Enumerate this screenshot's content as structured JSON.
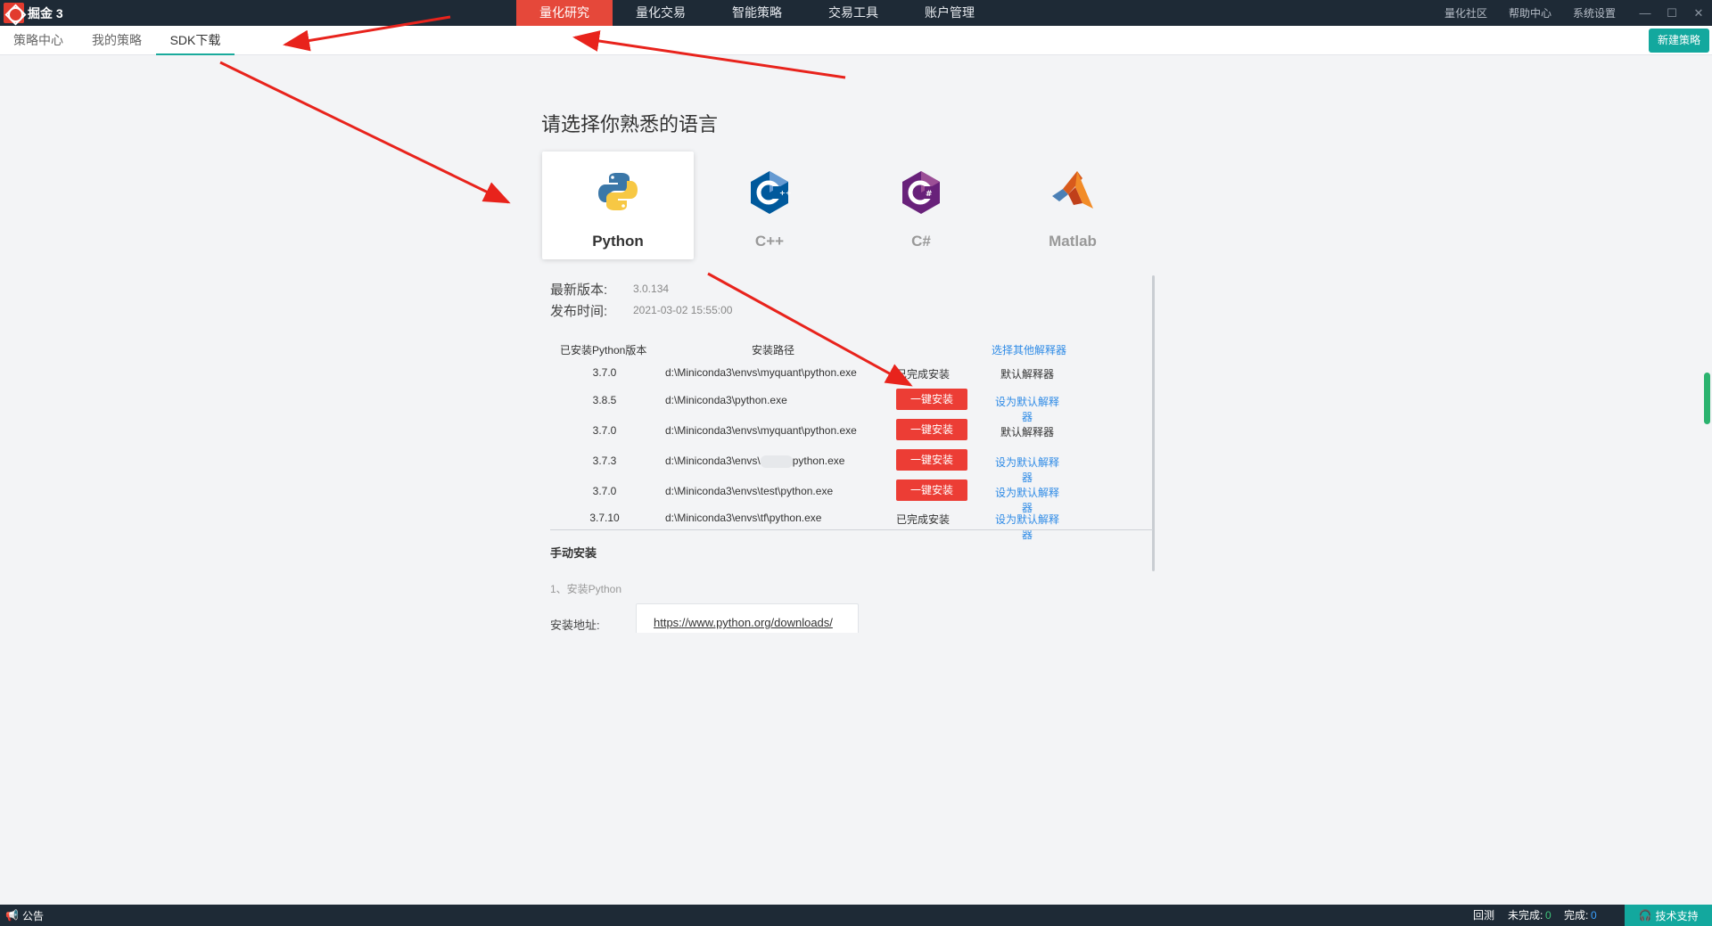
{
  "app": {
    "logo_text": "掘金 3"
  },
  "main_nav": [
    {
      "label": "量化研究",
      "active": true
    },
    {
      "label": "量化交易",
      "active": false
    },
    {
      "label": "智能策略",
      "active": false
    },
    {
      "label": "交易工具",
      "active": false
    },
    {
      "label": "账户管理",
      "active": false
    }
  ],
  "top_right": {
    "community": "量化社区",
    "help": "帮助中心",
    "settings": "系统设置"
  },
  "sub_nav": [
    {
      "label": "策略中心",
      "active": false
    },
    {
      "label": "我的策略",
      "active": false
    },
    {
      "label": "SDK下载",
      "active": true
    }
  ],
  "new_strategy_label": "新建策略",
  "heading": "请选择你熟悉的语言",
  "languages": [
    {
      "label": "Python",
      "selected": true,
      "icon": "python-icon"
    },
    {
      "label": "C++",
      "selected": false,
      "icon": "cpp-icon"
    },
    {
      "label": "C#",
      "selected": false,
      "icon": "csharp-icon"
    },
    {
      "label": "Matlab",
      "selected": false,
      "icon": "matlab-icon"
    }
  ],
  "version_info": {
    "latest_label": "最新版本:",
    "latest_value": "3.0.134",
    "release_label": "发布时间:",
    "release_value": "2021-03-02 15:55:00"
  },
  "table": {
    "headers": {
      "version": "已安装Python版本",
      "path": "安装路径",
      "choose_other": "选择其他解释器"
    },
    "rows": [
      {
        "version": "3.7.0",
        "path": "d:\\Miniconda3\\envs\\myquant\\python.exe",
        "status": "已完成安装",
        "default": "默认解释器"
      },
      {
        "version": "3.8.5",
        "path": "d:\\Miniconda3\\python.exe",
        "action": "一键安装",
        "default": "设为默认解释器"
      },
      {
        "version": "3.7.0",
        "path": "d:\\Miniconda3\\envs\\myquant\\python.exe",
        "action": "一键安装",
        "default": "默认解释器"
      },
      {
        "version": "3.7.3",
        "path_prefix": "d:\\Miniconda3\\envs\\",
        "path_suffix": "python.exe",
        "action": "一键安装",
        "default": "设为默认解释器"
      },
      {
        "version": "3.7.0",
        "path": "d:\\Miniconda3\\envs\\test\\python.exe",
        "action": "一键安装",
        "default": "设为默认解释器"
      },
      {
        "version": "3.7.10",
        "path": "d:\\Miniconda3\\envs\\tf\\python.exe",
        "status": "已完成安装",
        "default": "设为默认解释器"
      }
    ]
  },
  "manual": {
    "title": "手动安装",
    "step1": "1、安装Python",
    "address_label": "安装地址:",
    "address_link": "https://www.python.org/downloads/"
  },
  "status_bar": {
    "notice": "公告",
    "backtest": "回测",
    "incomplete_label": "未完成:",
    "incomplete_value": "0",
    "complete_label": "完成:",
    "complete_value": "0",
    "support": "技术支持"
  },
  "colors": {
    "accent_red": "#e5483a",
    "accent_teal": "#13a89e",
    "link_blue": "#2f8be6",
    "annotation_red": "#e8231c"
  }
}
